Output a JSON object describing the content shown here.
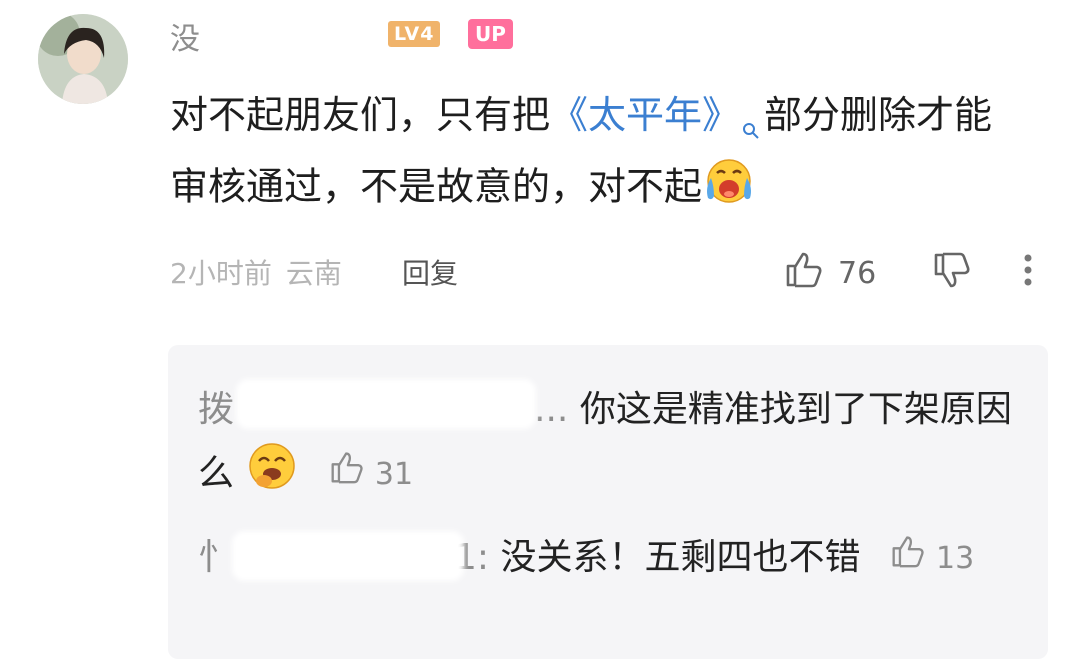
{
  "comment": {
    "username": "没",
    "level_badge": "LV4",
    "up_badge": "UP",
    "text_before": "对不起朋友们，只有把",
    "link_text": "《太平年》",
    "text_after": "部分删除才能审核通过，不是故意的，对不起",
    "time": "2小时前",
    "location": "云南",
    "reply_label": "回复",
    "like_count": "76"
  },
  "replies": [
    {
      "author": "拨",
      "author_tail": "...",
      "text": "你这是精准找到了下架原因么",
      "like_count": "31",
      "emoji": "laughing-face-emoji"
    },
    {
      "author": "忄",
      "author_tail": "1:",
      "text": "没关系！五剩四也不错",
      "like_count": "13"
    }
  ],
  "icons": [
    "search-icon",
    "crying-face-emoji",
    "thumbs-up-icon",
    "thumbs-down-icon",
    "more-icon"
  ],
  "colors": {
    "link": "#3b7fd1",
    "up_badge": "#ff6f9c",
    "level_badge": "#f0b36a",
    "reply_bg": "#f5f5f7"
  }
}
